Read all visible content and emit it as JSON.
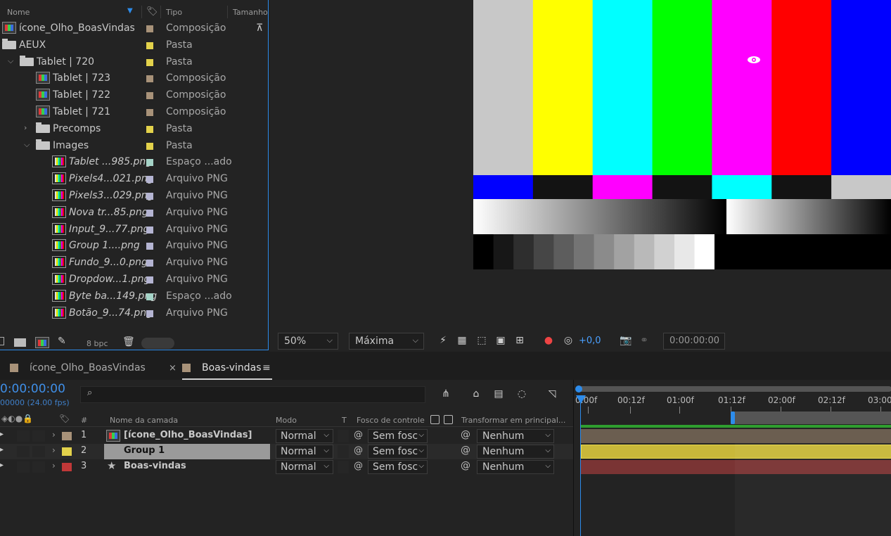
{
  "project": {
    "columns": {
      "name": "Nome",
      "type": "Tipo",
      "size": "Tamanho"
    },
    "items": [
      {
        "name": "ícone_Olho_BoasVindas",
        "type": "Composição",
        "icon": "composition-icon",
        "color": "#a89279",
        "italic": false
      },
      {
        "name": "AEUX",
        "type": "Pasta",
        "icon": "folder-icon",
        "color": "#e3d24b",
        "italic": false
      },
      {
        "name": "Tablet | 720",
        "type": "Pasta",
        "icon": "folder-icon",
        "color": "#e3d24b",
        "italic": false,
        "twirl": "v"
      },
      {
        "name": "Tablet | 723",
        "type": "Composição",
        "icon": "composition-icon",
        "color": "#a89279",
        "italic": false
      },
      {
        "name": "Tablet | 722",
        "type": "Composição",
        "icon": "composition-icon",
        "color": "#a89279",
        "italic": false
      },
      {
        "name": "Tablet | 721",
        "type": "Composição",
        "icon": "composition-icon",
        "color": "#a89279",
        "italic": false
      },
      {
        "name": "Precomps",
        "type": "Pasta",
        "icon": "folder-icon",
        "color": "#e3d24b",
        "italic": false,
        "twirl": ">"
      },
      {
        "name": "Images",
        "type": "Pasta",
        "icon": "folder-icon",
        "color": "#e3d24b",
        "italic": false,
        "twirl": "v"
      },
      {
        "name": "Tablet ...985.png",
        "type": "Espaço ...ado",
        "icon": "png-icon",
        "color": "#a5d4c8",
        "italic": true
      },
      {
        "name": "Pixels4...021.png",
        "type": "Arquivo PNG",
        "icon": "png-icon",
        "color": "#b4b4d2",
        "italic": true
      },
      {
        "name": "Pixels3...029.png",
        "type": "Arquivo PNG",
        "icon": "png-icon",
        "color": "#b4b4d2",
        "italic": true
      },
      {
        "name": "Nova tr...85.png",
        "type": "Arquivo PNG",
        "icon": "png-icon",
        "color": "#b4b4d2",
        "italic": true
      },
      {
        "name": "Input_9...77.png",
        "type": "Arquivo PNG",
        "icon": "png-icon",
        "color": "#b4b4d2",
        "italic": true
      },
      {
        "name": "Group 1....png",
        "type": "Arquivo PNG",
        "icon": "png-icon",
        "color": "#b4b4d2",
        "italic": true
      },
      {
        "name": "Fundo_9...0.png",
        "type": "Arquivo PNG",
        "icon": "png-icon",
        "color": "#b4b4d2",
        "italic": true
      },
      {
        "name": "Dropdow...1.png",
        "type": "Arquivo PNG",
        "icon": "png-icon",
        "color": "#b4b4d2",
        "italic": true
      },
      {
        "name": "Byte ba...149.png",
        "type": "Espaço ...ado",
        "icon": "png-icon",
        "color": "#a5d4c8",
        "italic": true
      },
      {
        "name": "Botão_9...74.png",
        "type": "Arquivo PNG",
        "icon": "png-icon",
        "color": "#b4b4d2",
        "italic": true
      }
    ],
    "footer": {
      "bpc": "8 bpc"
    }
  },
  "viewer": {
    "zoom": "50%",
    "resolution": "Máxima",
    "exposure": "+0,0",
    "timecode": "0:00:00:00"
  },
  "timeline": {
    "tabs": [
      {
        "label": "ícone_Olho_BoasVindas",
        "color": "#a89279",
        "active": false
      },
      {
        "label": "Boas-vindas",
        "color": "#a89279",
        "active": true
      }
    ],
    "current_time": "0:00:00:00",
    "frame_info": "00000 (24.00 fps)",
    "columns": {
      "num": "#",
      "layer_name": "Nome da camada",
      "mode": "Modo",
      "t": "T",
      "track_matte": "Fosco de controle",
      "parent": "Transformar em principal..."
    },
    "layers": [
      {
        "num": "1",
        "name": "[ícone_Olho_BoasVindas]",
        "color": "#a89279",
        "mode": "Normal",
        "matte": "Sem fosco",
        "parent": "Nenhum",
        "selected": false,
        "bar": "#6b5e50"
      },
      {
        "num": "2",
        "name": "Group 1",
        "color": "#e3d24b",
        "mode": "Normal",
        "matte": "Sem fosco",
        "parent": "Nenhum",
        "selected": true,
        "bar": "#c8b83a"
      },
      {
        "num": "3",
        "name": "Boas-vindas",
        "color": "#c03838",
        "mode": "Normal",
        "matte": "Sem fosco",
        "parent": "Nenhum",
        "selected": false,
        "bar": "#7a3434"
      }
    ],
    "ruler": [
      "0:00f",
      "00:12f",
      "01:00f",
      "01:12f",
      "02:00f",
      "02:12f",
      "03:00"
    ]
  }
}
